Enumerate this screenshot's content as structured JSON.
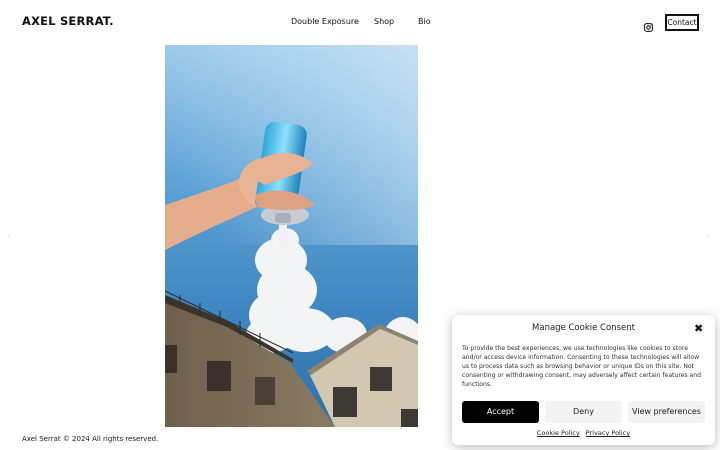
{
  "header": {
    "logo": "AXEL SERRAT.",
    "nav": [
      "Double Exposure",
      "Shop",
      "Bio"
    ],
    "instagram_icon": "instagram-icon",
    "contact_label": "Contact"
  },
  "carousel": {
    "prev_icon": "chevron-left-icon",
    "next_icon": "chevron-right-icon",
    "prev_glyph": "‹",
    "next_glyph": "›"
  },
  "footer": {
    "copyright": "Axel Serrat © 2024 All rights reserved."
  },
  "cookie_banner": {
    "title": "Manage Cookie Consent",
    "close_glyph": "✖",
    "text": "To provide the best experiences, we use technologies like cookies to store and/or access device information. Consenting to these technologies will allow us to process data such as browsing behavior or unique IDs on this site. Not consenting or withdrawing consent, may adversely affect certain features and functions.",
    "accept_label": "Accept",
    "deny_label": "Deny",
    "preferences_label": "View preferences",
    "cookie_policy_label": "Cookie Policy",
    "privacy_policy_label": "Privacy Policy"
  }
}
